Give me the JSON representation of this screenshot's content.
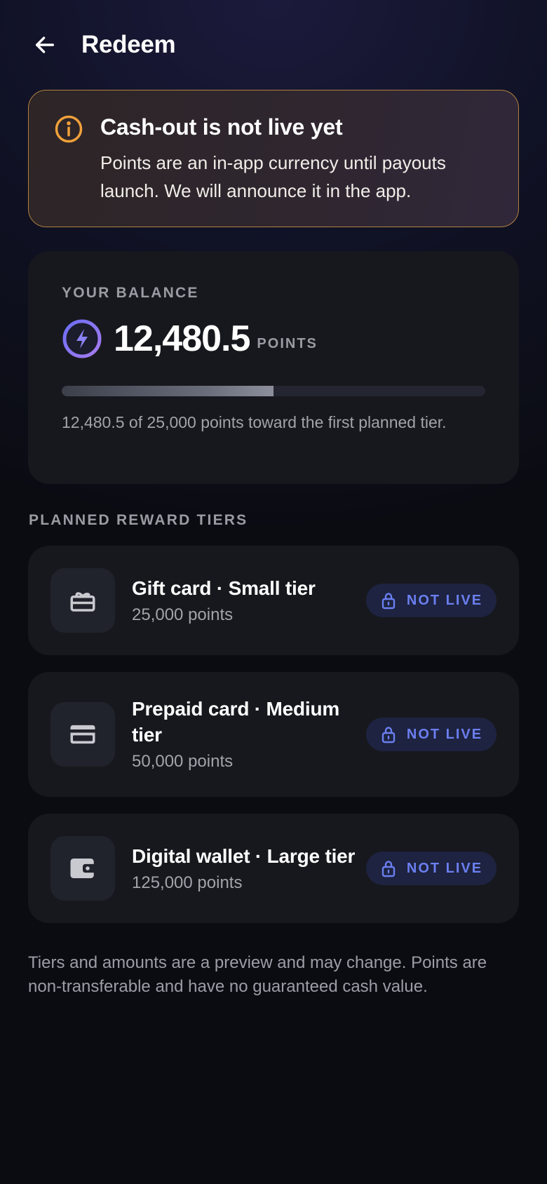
{
  "header": {
    "title": "Redeem",
    "back_icon": "arrow-left-icon"
  },
  "notice": {
    "title": "Cash-out is not live yet",
    "body": "Points are an in-app currency until payouts launch. We will announce it in the app.",
    "icon": "info-icon",
    "accent": "#f0a13b"
  },
  "balance": {
    "eyebrow": "YOUR BALANCE",
    "value": "12,480.5",
    "unit": "POINTS",
    "icon": "bolt-icon",
    "progress_fraction": 0.4992,
    "progress_note": "12,480.5 of 25,000 points toward the first planned tier."
  },
  "section_title": "PLANNED REWARD TIERS",
  "tiers": [
    {
      "name": "Gift card · Small tier",
      "points": "25,000 points",
      "icon": "gift-card-icon",
      "status": "NOT LIVE",
      "status_icon": "lock-icon"
    },
    {
      "name": "Prepaid card · Medium tier",
      "points": "50,000 points",
      "icon": "credit-card-icon",
      "status": "NOT LIVE",
      "status_icon": "lock-icon"
    },
    {
      "name": "Digital wallet · Large tier",
      "points": "125,000 points",
      "icon": "wallet-icon",
      "status": "NOT LIVE",
      "status_icon": "lock-icon"
    }
  ],
  "footer_note": "Tiers and amounts are a preview and may change. Points are non-transferable and have no guaranteed cash value.",
  "colors": {
    "badge_text": "#6b7ff0",
    "badge_bg": "#1d2340",
    "bolt_ring": "#7f74f2"
  }
}
